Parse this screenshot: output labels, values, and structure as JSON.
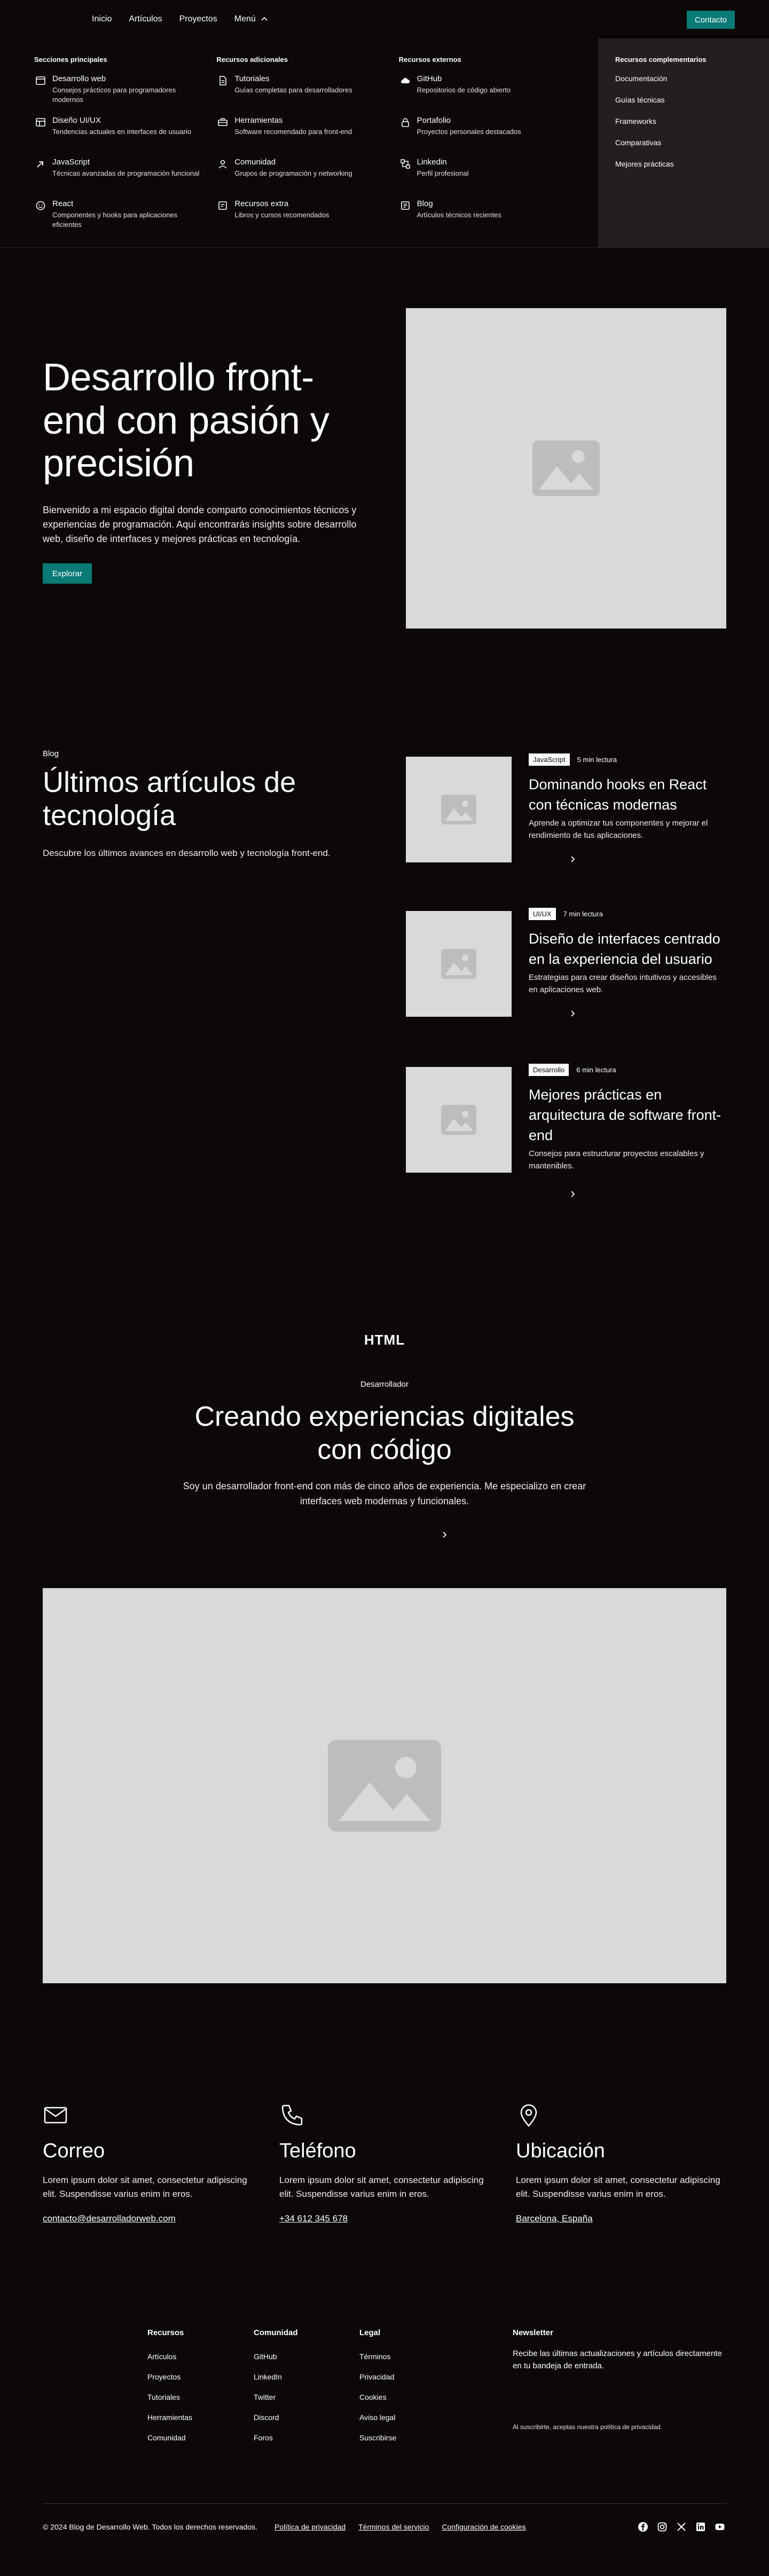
{
  "nav": {
    "links": [
      "Inicio",
      "Artículos",
      "Proyectos"
    ],
    "menu_label": "Menú",
    "contact_label": "Contacto"
  },
  "mega": {
    "columns": [
      {
        "title": "Secciones principales",
        "items": [
          {
            "icon": "browser-icon",
            "title": "Desarrollo web",
            "desc": "Consejos prácticos para programadores modernos"
          },
          {
            "icon": "layout-icon",
            "title": "Diseño UI/UX",
            "desc": "Tendencias actuales en interfaces de usuario"
          },
          {
            "icon": "arrow-icon",
            "title": "JavaScript",
            "desc": "Técnicas avanzadas de programación funcional"
          },
          {
            "icon": "atom-icon",
            "title": "React",
            "desc": "Componentes y hooks para aplicaciones eficientes"
          }
        ]
      },
      {
        "title": "Recursos adicionales",
        "items": [
          {
            "icon": "document-icon",
            "title": "Tutoriales",
            "desc": "Guías completas para desarrolladores"
          },
          {
            "icon": "tools-icon",
            "title": "Herramientas",
            "desc": "Software recomendado para front-end"
          },
          {
            "icon": "people-icon",
            "title": "Comunidad",
            "desc": "Grupos de programación y networking"
          },
          {
            "icon": "book-icon",
            "title": "Recursos extra",
            "desc": "Libros y cursos recomendados"
          }
        ]
      },
      {
        "title": "Recursos externos",
        "items": [
          {
            "icon": "cloud-icon",
            "title": "GitHub",
            "desc": "Repositorios de código abierto"
          },
          {
            "icon": "lock-icon",
            "title": "Portafolio",
            "desc": "Proyectos personales destacados"
          },
          {
            "icon": "linkedin-icon",
            "title": "Linkedin",
            "desc": "Perfil profesional"
          },
          {
            "icon": "blog-icon",
            "title": "Blog",
            "desc": "Artículos técnicos recientes"
          }
        ]
      }
    ],
    "side": {
      "title": "Recursos complementarios",
      "links": [
        "Documentación",
        "Guías técnicas",
        "Frameworks",
        "Comparativas",
        "Mejores prácticas"
      ]
    }
  },
  "hero": {
    "title": "Desarrollo front-end con pasión y precisión",
    "text": "Bienvenido a mi espacio digital donde comparto conocimientos técnicos y experiencias de programación. Aquí encontrarás insights sobre desarrollo web, diseño de interfaces y mejores prácticas en tecnología.",
    "button": "Explorar"
  },
  "blog": {
    "tag": "Blog",
    "title": "Últimos artículos de tecnología",
    "subtitle": "Descubre los últimos avances en desarrollo web y tecnología front-end.",
    "posts": [
      {
        "badge": "JavaScript",
        "read": "5 min lectura",
        "title": "Dominando hooks en React con técnicas modernas",
        "desc": "Aprende a optimizar tus componentes y mejorar el rendimiento de tus aplicaciones."
      },
      {
        "badge": "UI/UX",
        "read": "7 min lectura",
        "title": "Diseño de interfaces centrado en la experiencia del usuario",
        "desc": "Estrategias para crear diseños intuitivos y accesibles en aplicaciones web."
      },
      {
        "badge": "Desarrollo",
        "read": "6 min lectura",
        "title": "Mejores prácticas en arquitectura de software front-end",
        "desc": "Consejos para estructurar proyectos escalables y mantenibles."
      }
    ]
  },
  "about": {
    "logo": "HTML",
    "tag": "Desarrollador",
    "title": "Creando experiencias digitales con código",
    "text": "Soy un desarrollador front-end con más de cinco años de experiencia. Me especializo en crear interfaces web modernas y funcionales."
  },
  "contact": [
    {
      "icon": "mail-icon",
      "title": "Correo",
      "text": "Lorem ipsum dolor sit amet, consectetur adipiscing elit. Suspendisse varius enim in eros.",
      "link": "contacto@desarrolladorweb.com"
    },
    {
      "icon": "phone-icon",
      "title": "Teléfono",
      "text": "Lorem ipsum dolor sit amet, consectetur adipiscing elit. Suspendisse varius enim in eros.",
      "link": "+34 612 345 678"
    },
    {
      "icon": "location-icon",
      "title": "Ubicación",
      "text": "Lorem ipsum dolor sit amet, consectetur adipiscing elit. Suspendisse varius enim in eros.",
      "link": "Barcelona, España"
    }
  ],
  "footer": {
    "columns": [
      {
        "title": "Recursos",
        "links": [
          "Artículos",
          "Proyectos",
          "Tutoriales",
          "Herramientas",
          "Comunidad"
        ]
      },
      {
        "title": "Comunidad",
        "links": [
          "GitHub",
          "LinkedIn",
          "Twitter",
          "Discord",
          "Foros"
        ]
      },
      {
        "title": "Legal",
        "links": [
          "Términos",
          "Privacidad",
          "Cookies",
          "Aviso legal",
          "Suscribirse"
        ]
      }
    ],
    "newsletter": {
      "title": "Newsletter",
      "text": "Recibe las últimas actualizaciones y artículos directamente en tu bandeja de entrada.",
      "fine": "Al suscribirte, aceptas nuestra política de privacidad."
    },
    "copyright": "© 2024 Blog de Desarrollo Web. Todos los derechos reservados.",
    "legal_links": [
      "Política de privacidad",
      "Términos del servicio",
      "Configuración de cookies"
    ],
    "socials": [
      "facebook-icon",
      "instagram-icon",
      "x-icon",
      "linkedin-icon",
      "youtube-icon"
    ]
  },
  "colors": {
    "accent": "#0a7a76",
    "background": "#0c0808",
    "placeholder": "#d9d9d9",
    "side_panel": "#241f1e"
  }
}
